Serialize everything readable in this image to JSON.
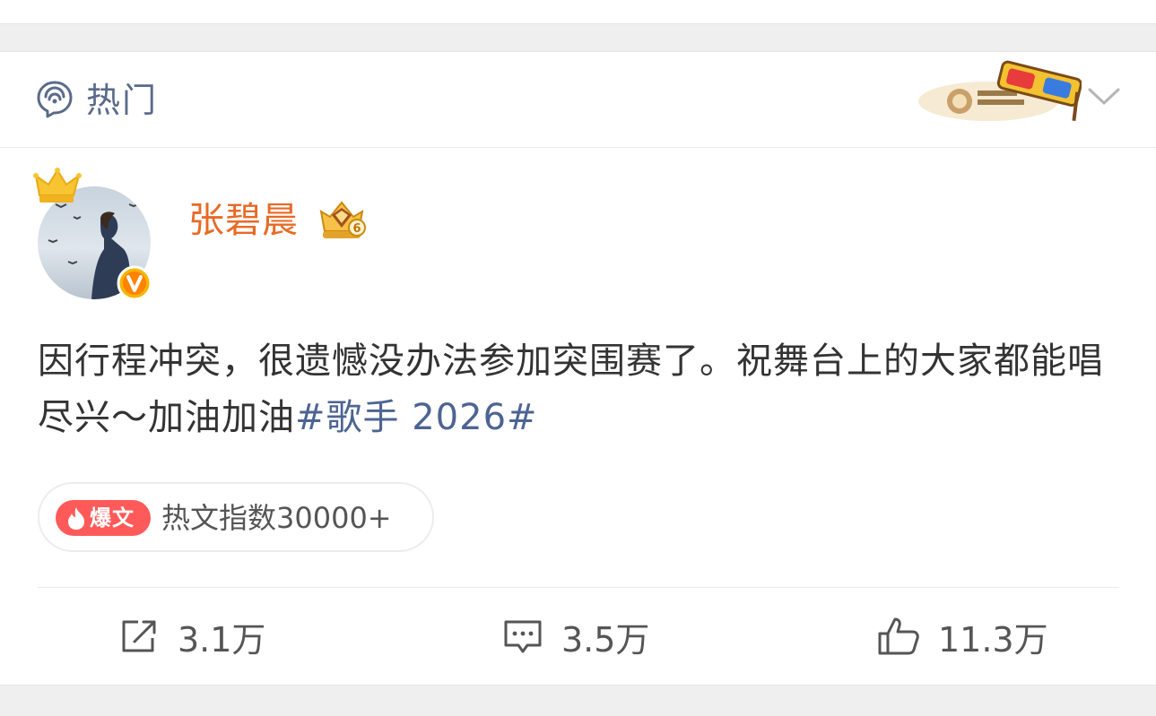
{
  "header": {
    "label": "热门"
  },
  "post": {
    "username": "张碧晨",
    "text": "因行程冲突，很遗憾没办法参加突围赛了。祝舞台上的大家都能唱尽兴～加油加油",
    "hashtag": "#歌手 2026#",
    "hot_badge": {
      "tag": "爆文",
      "index_text": "热文指数30000+"
    }
  },
  "actions": {
    "repost_count": "3.1万",
    "comment_count": "3.5万",
    "like_count": "11.3万"
  },
  "colors": {
    "username": "#e86a25",
    "hashtag": "#4d6493",
    "boom_tag_bg": "#ff5a5a"
  },
  "icons": [
    "hot-topic-icon",
    "chevron-down-icon",
    "crown-icon",
    "verified-icon",
    "vip-badge-icon",
    "flame-icon",
    "repost-icon",
    "comment-icon",
    "like-icon"
  ]
}
